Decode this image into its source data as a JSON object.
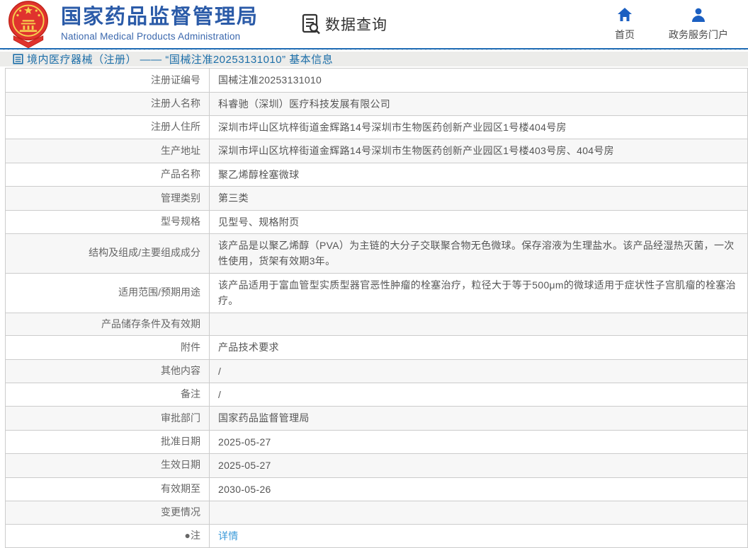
{
  "header": {
    "title_cn": "国家药品监督管理局",
    "title_en": "National Medical Products Administration",
    "logo_name": "national-emblem",
    "section_label": "数据查询",
    "nav": [
      {
        "label": "首页",
        "icon": "home-icon"
      },
      {
        "label": "政务服务门户",
        "icon": "user-icon"
      }
    ]
  },
  "breadcrumb": {
    "text": "境内医疗器械（注册） —— “国械注准20253131010” 基本信息"
  },
  "table": {
    "rows": [
      {
        "label": "注册证编号",
        "value": "国械注准20253131010"
      },
      {
        "label": "注册人名称",
        "value": "科睿驰（深圳）医疗科技发展有限公司"
      },
      {
        "label": "注册人住所",
        "value": "深圳市坪山区坑梓街道金辉路14号深圳市生物医药创新产业园区1号楼404号房"
      },
      {
        "label": "生产地址",
        "value": "深圳市坪山区坑梓街道金辉路14号深圳市生物医药创新产业园区1号楼403号房、404号房"
      },
      {
        "label": "产品名称",
        "value": "聚乙烯醇栓塞微球"
      },
      {
        "label": "管理类别",
        "value": "第三类"
      },
      {
        "label": "型号规格",
        "value": "见型号、规格附页"
      },
      {
        "label": "结构及组成/主要组成成分",
        "value": "该产品是以聚乙烯醇（PVA）为主链的大分子交联聚合物无色微球。保存溶液为生理盐水。该产品经湿热灭菌，一次性使用，货架有效期3年。"
      },
      {
        "label": "适用范围/预期用途",
        "value": "该产品适用于富血管型实质型器官恶性肿瘤的栓塞治疗，粒径大于等于500μm的微球适用于症状性子宫肌瘤的栓塞治疗。"
      },
      {
        "label": "产品储存条件及有效期",
        "value": ""
      },
      {
        "label": "附件",
        "value": "产品技术要求"
      },
      {
        "label": "其他内容",
        "value": "/"
      },
      {
        "label": "备注",
        "value": "/"
      },
      {
        "label": "审批部门",
        "value": "国家药品监督管理局"
      },
      {
        "label": "批准日期",
        "value": "2025-05-27"
      },
      {
        "label": "生效日期",
        "value": "2025-05-27"
      },
      {
        "label": "有效期至",
        "value": "2030-05-26"
      },
      {
        "label": "变更情况",
        "value": ""
      },
      {
        "label": "●注",
        "value": "详情",
        "link": true
      }
    ]
  },
  "colors": {
    "brand-blue": "#2b5ba8",
    "icon-blue": "#1b5fc1",
    "rule-blue": "#1f6cb5",
    "crumb-bg": "#ececea",
    "crumb-text": "#1c6ea8",
    "link-blue": "#3a9ad9",
    "border-gray": "#cccccc",
    "stripe-gray": "#f7f7f7",
    "text-gray": "#555555",
    "label-gray": "#666666"
  }
}
